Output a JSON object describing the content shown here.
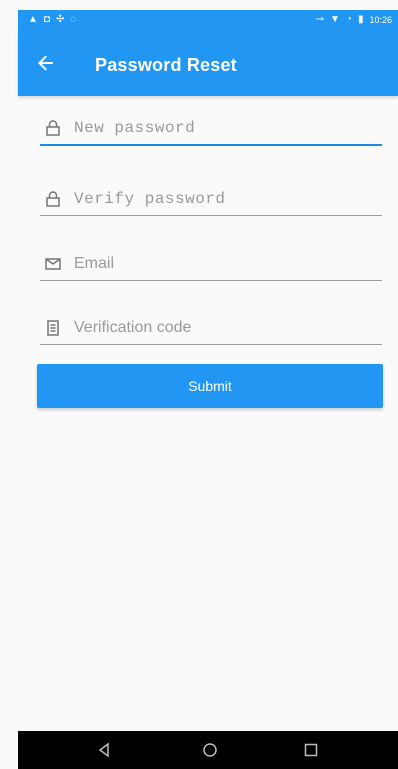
{
  "status_bar": {
    "time": "10:26"
  },
  "app_bar": {
    "title": "Password Reset"
  },
  "form": {
    "new_password": {
      "placeholder": "New password",
      "value": ""
    },
    "verify_password": {
      "placeholder": "Verify password",
      "value": ""
    },
    "email": {
      "placeholder": "Email",
      "value": ""
    },
    "verification_code": {
      "placeholder": "Verification code",
      "value": ""
    },
    "submit_label": "Submit"
  },
  "colors": {
    "primary": "#2196f3",
    "underline_active": "#1e88e5",
    "underline": "#9e9e9e",
    "nav_bar": "#000000"
  },
  "icons": {
    "back": "arrow-back-icon",
    "new_password": "lock-icon",
    "verify_password": "lock-icon",
    "email": "mail-icon",
    "verification_code": "verification-code-icon",
    "nav_back": "triangle-back-icon",
    "nav_home": "circle-home-icon",
    "nav_recents": "square-recents-icon"
  }
}
